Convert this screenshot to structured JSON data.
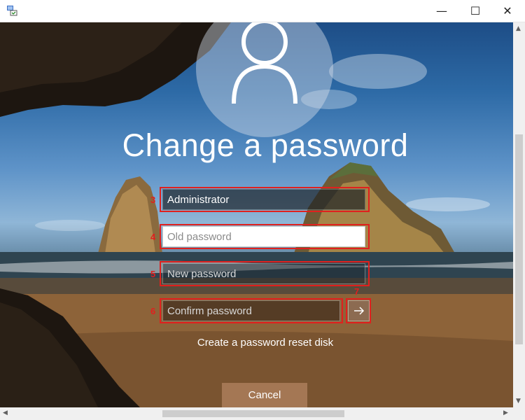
{
  "window": {
    "minimize_glyph": "—",
    "maximize_glyph": "☐",
    "close_glyph": "✕"
  },
  "form": {
    "heading": "Change a password",
    "username_value": "Administrator",
    "old_password_placeholder": "Old password",
    "new_password_placeholder": "New password",
    "confirm_password_placeholder": "Confirm password",
    "submit_icon": "arrow-right-icon",
    "reset_link": "Create a password reset disk",
    "cancel_label": "Cancel"
  },
  "annotations": {
    "username": "3",
    "old_password": "4",
    "new_password": "5",
    "confirm_password": "6",
    "submit": "7"
  },
  "colors": {
    "annotation": "#e0201e",
    "title_text": "#ffffff"
  }
}
